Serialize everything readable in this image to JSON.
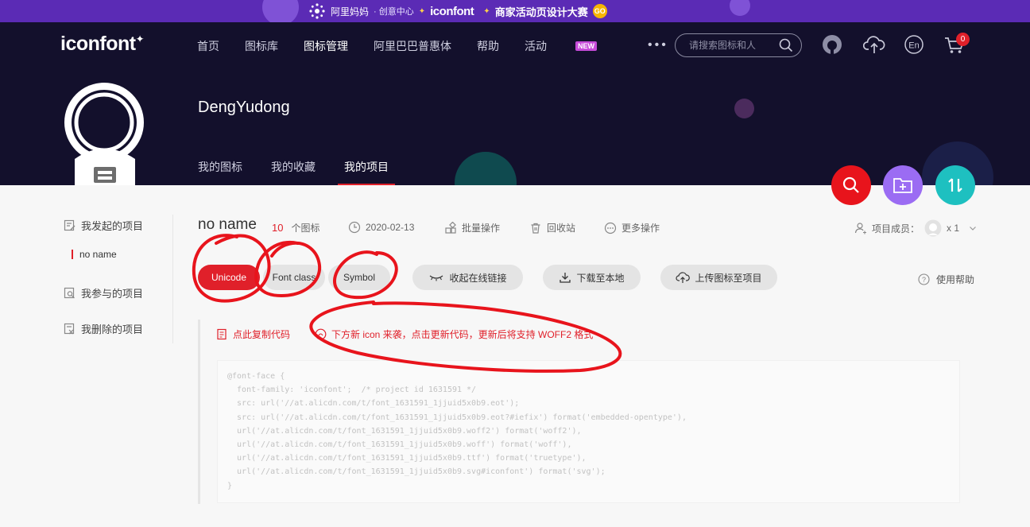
{
  "banner": {
    "brand": "阿里妈妈",
    "sub": "· 创意中心",
    "logo": "iconfont",
    "campaign": "商家活动页设计大赛",
    "go": "GO"
  },
  "header": {
    "logo": "iconfont",
    "nav": [
      "首页",
      "图标库",
      "图标管理",
      "阿里巴巴普惠体",
      "帮助",
      "活动"
    ],
    "new_badge": "NEW",
    "more": "•••",
    "search_placeholder": "请搜索图标和人",
    "lang": "En",
    "cart_count": "0"
  },
  "profile": {
    "username": "DengYudong",
    "tabs": [
      "我的图标",
      "我的收藏",
      "我的项目"
    ]
  },
  "sidebar": {
    "started": "我发起的项目",
    "current_project": "no name",
    "joined": "我参与的项目",
    "deleted": "我删除的项目"
  },
  "project": {
    "name": "no name",
    "icon_count": "10",
    "icon_unit": "个图标",
    "date": "2020-02-13",
    "batch": "批量操作",
    "recycle": "回收站",
    "more_ops": "更多操作",
    "members_label": "项目成员：",
    "members_count": "x 1"
  },
  "buttons": {
    "unicode": "Unicode",
    "font_class": "Font class",
    "symbol": "Symbol",
    "collapse": "收起在线链接",
    "download": "下载至本地",
    "upload": "上传图标至项目",
    "help": "使用帮助"
  },
  "code_area": {
    "copy": "点此复制代码",
    "notice": "下方新 icon 来袭，点击更新代码，更新后将支持 WOFF2 格式",
    "code": "@font-face {\n  font-family: 'iconfont';  /* project id 1631591 */\n  src: url('//at.alicdn.com/t/font_1631591_1jjuid5x0b9.eot');\n  src: url('//at.alicdn.com/t/font_1631591_1jjuid5x0b9.eot?#iefix') format('embedded-opentype'),\n  url('//at.alicdn.com/t/font_1631591_1jjuid5x0b9.woff2') format('woff2'),\n  url('//at.alicdn.com/t/font_1631591_1jjuid5x0b9.woff') format('woff'),\n  url('//at.alicdn.com/t/font_1631591_1jjuid5x0b9.ttf') format('truetype'),\n  url('//at.alicdn.com/t/font_1631591_1jjuid5x0b9.svg#iconfont') format('svg');\n}"
  },
  "colors": {
    "accent": "#e0202a",
    "header_bg": "#13102c",
    "banner_bg": "#5b2bb5",
    "fab_search": "#e8141c",
    "fab_folder": "#9b6cf3",
    "fab_sort": "#1ec0c0",
    "annotation": "#e8141c"
  }
}
